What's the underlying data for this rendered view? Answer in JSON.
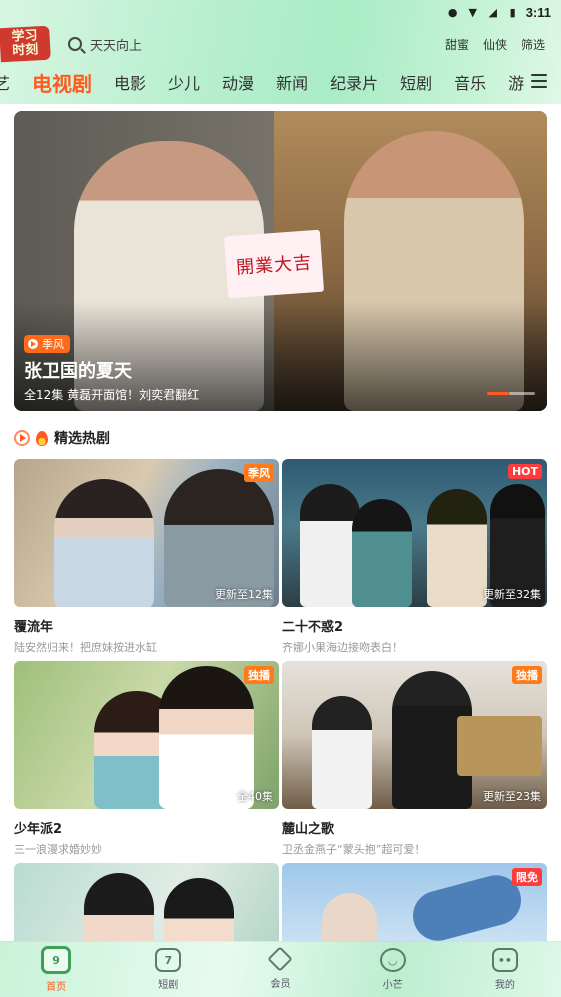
{
  "status_bar": {
    "time": "3:11"
  },
  "header": {
    "logo_line1": "学习",
    "logo_line2": "时刻",
    "search_placeholder": "天天向上",
    "quick_links": [
      "甜蜜",
      "仙侠",
      "筛选"
    ]
  },
  "channel_tabs": {
    "partial_left": "艺",
    "items": [
      "电视剧",
      "电影",
      "少儿",
      "动漫",
      "新闻",
      "纪录片",
      "短剧",
      "音乐",
      "游"
    ],
    "active": "电视剧"
  },
  "banner": {
    "badge": "季风",
    "sign_text": "開業大吉",
    "title": "张卫国的夏天",
    "subtitle": "全12集 黄磊开面馆！刘奕君翻红"
  },
  "section": {
    "title": "精选热剧"
  },
  "cards": [
    {
      "title": "覆流年",
      "subtitle": "陆安然归来！把庶妹按进水缸",
      "tag": "季风",
      "tag_color": "#ff7a1a",
      "episode": "更新至12集"
    },
    {
      "title": "二十不惑2",
      "subtitle": "齐娜小果海边接吻表白！",
      "tag": "HOT",
      "tag_color": "#ff3b3b",
      "episode": "更新至32集"
    },
    {
      "title": "少年派2",
      "subtitle": "三一浪漫求婚妙妙",
      "tag": "独播",
      "tag_color": "#ff7a1a",
      "episode": "全40集"
    },
    {
      "title": "麓山之歌",
      "subtitle": "卫丞金燕子“蒙头抱”超可爱！",
      "tag": "独播",
      "tag_color": "#ff7a1a",
      "episode": "更新至23集"
    },
    {
      "title": "",
      "subtitle": "",
      "tag": "",
      "tag_color": "",
      "episode": ""
    },
    {
      "title": "",
      "subtitle": "",
      "tag": "限免",
      "tag_color": "#ff3b3b",
      "episode": ""
    }
  ],
  "bottom_nav": [
    {
      "label": "首页",
      "icon": "home-icon",
      "active": true
    },
    {
      "label": "短剧",
      "icon": "tv-icon",
      "active": false
    },
    {
      "label": "会员",
      "icon": "vip-diamond-icon",
      "active": false
    },
    {
      "label": "小芒",
      "icon": "mango-icon",
      "active": false
    },
    {
      "label": "我的",
      "icon": "profile-icon",
      "active": false
    }
  ],
  "colors": {
    "accent": "#ff5a1f",
    "header_green": "#b9efcf"
  }
}
